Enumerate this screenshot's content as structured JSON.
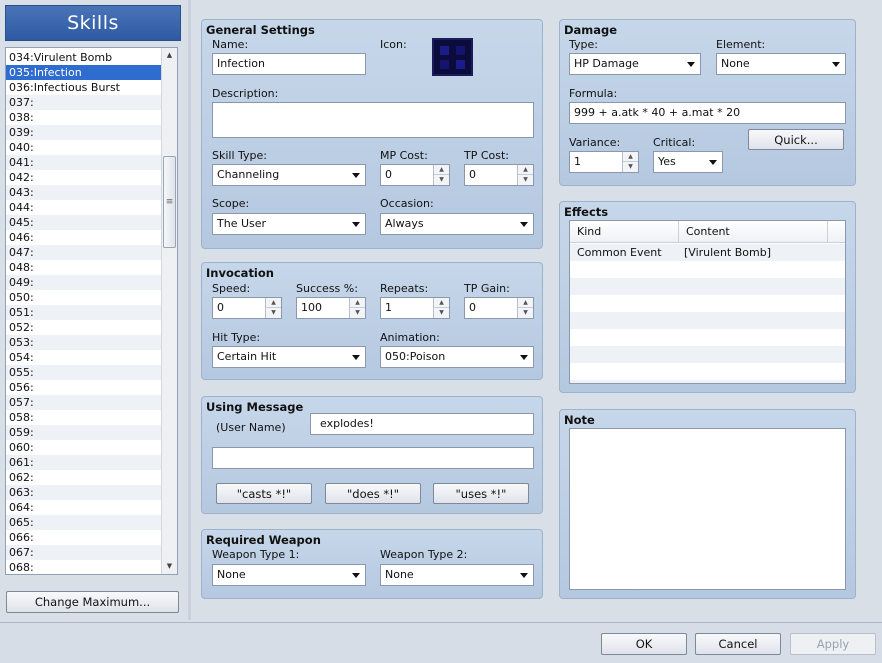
{
  "left": {
    "header": "Skills",
    "change_max_label": "Change Maximum...",
    "skills": [
      {
        "label": "034:Virulent Bomb"
      },
      {
        "label": "035:Infection",
        "selected": true
      },
      {
        "label": "036:Infectious Burst"
      },
      {
        "label": "037:"
      },
      {
        "label": "038:"
      },
      {
        "label": "039:"
      },
      {
        "label": "040:"
      },
      {
        "label": "041:"
      },
      {
        "label": "042:"
      },
      {
        "label": "043:"
      },
      {
        "label": "044:"
      },
      {
        "label": "045:"
      },
      {
        "label": "046:"
      },
      {
        "label": "047:"
      },
      {
        "label": "048:"
      },
      {
        "label": "049:"
      },
      {
        "label": "050:"
      },
      {
        "label": "051:"
      },
      {
        "label": "052:"
      },
      {
        "label": "053:"
      },
      {
        "label": "054:"
      },
      {
        "label": "055:"
      },
      {
        "label": "056:"
      },
      {
        "label": "057:"
      },
      {
        "label": "058:"
      },
      {
        "label": "059:"
      },
      {
        "label": "060:"
      },
      {
        "label": "061:"
      },
      {
        "label": "062:"
      },
      {
        "label": "063:"
      },
      {
        "label": "064:"
      },
      {
        "label": "065:"
      },
      {
        "label": "066:"
      },
      {
        "label": "067:"
      },
      {
        "label": "068:"
      }
    ]
  },
  "general": {
    "title": "General Settings",
    "name_label": "Name:",
    "name_value": "Infection",
    "icon_label": "Icon:",
    "description_label": "Description:",
    "description_value": "",
    "skill_type_label": "Skill Type:",
    "skill_type_value": "Channeling",
    "mp_cost_label": "MP Cost:",
    "mp_cost_value": "0",
    "tp_cost_label": "TP Cost:",
    "tp_cost_value": "0",
    "scope_label": "Scope:",
    "scope_value": "The User",
    "occasion_label": "Occasion:",
    "occasion_value": "Always"
  },
  "invocation": {
    "title": "Invocation",
    "speed_label": "Speed:",
    "speed_value": "0",
    "success_label": "Success %:",
    "success_value": "100",
    "repeats_label": "Repeats:",
    "repeats_value": "1",
    "tp_gain_label": "TP Gain:",
    "tp_gain_value": "0",
    "hit_type_label": "Hit Type:",
    "hit_type_value": "Certain Hit",
    "animation_label": "Animation:",
    "animation_value": "050:Poison"
  },
  "message": {
    "title": "Using Message",
    "user_name_label": "(User Name)",
    "line1_value": "explodes!",
    "line2_value": "",
    "casts_label": "\"casts *!\"",
    "does_label": "\"does *!\"",
    "uses_label": "\"uses *!\""
  },
  "weapon": {
    "title": "Required Weapon",
    "type1_label": "Weapon Type 1:",
    "type1_value": "None",
    "type2_label": "Weapon Type 2:",
    "type2_value": "None"
  },
  "damage": {
    "title": "Damage",
    "type_label": "Type:",
    "type_value": "HP Damage",
    "element_label": "Element:",
    "element_value": "None",
    "formula_label": "Formula:",
    "formula_value": "999 + a.atk * 40 + a.mat * 20",
    "variance_label": "Variance:",
    "variance_value": "1",
    "critical_label": "Critical:",
    "critical_value": "Yes",
    "quick_label": "Quick..."
  },
  "effects": {
    "title": "Effects",
    "columns": [
      "Kind",
      "Content"
    ],
    "rows": [
      {
        "kind": "Common Event",
        "content": "[Virulent Bomb]"
      }
    ]
  },
  "note": {
    "title": "Note",
    "value": ""
  },
  "footer": {
    "ok_label": "OK",
    "cancel_label": "Cancel",
    "apply_label": "Apply"
  }
}
